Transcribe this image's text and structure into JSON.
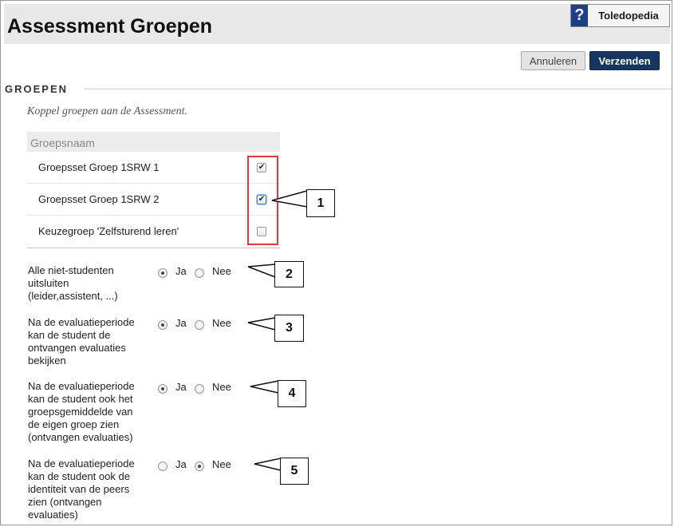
{
  "header": {
    "title": "Assessment Groepen",
    "help_icon": "question-mark",
    "help_label": "Toledopedia"
  },
  "actions": {
    "cancel_label": "Annuleren",
    "submit_label": "Verzenden"
  },
  "section": {
    "title": "GROEPEN",
    "description": "Koppel groepen aan de Assessment."
  },
  "groups": {
    "column_header": "Groepsnaam",
    "rows": [
      {
        "name": "Groepsset Groep 1SRW 1",
        "checked": true
      },
      {
        "name": "Groepsset Groep 1SRW 2",
        "checked": true
      },
      {
        "name": "Keuzegroep 'Zelfsturend leren'",
        "checked": false
      }
    ]
  },
  "options": [
    {
      "label_lines": [
        "Alle niet-studenten",
        "uitsluiten",
        "(leider,assistent, ...)"
      ],
      "yes": "Ja",
      "no": "Nee",
      "selected": "Ja"
    },
    {
      "label_lines": [
        "Na de evaluatieperiode",
        "kan de student de",
        "ontvangen evaluaties",
        "bekijken"
      ],
      "yes": "Ja",
      "no": "Nee",
      "selected": "Ja"
    },
    {
      "label_lines": [
        "Na de evaluatieperiode",
        "kan de student ook het",
        "groepsgemiddelde van",
        "de eigen groep zien",
        "(ontvangen evaluaties)"
      ],
      "yes": "Ja",
      "no": "Nee",
      "selected": "Ja"
    },
    {
      "label_lines": [
        "Na de evaluatieperiode",
        "kan de student ook de",
        "identiteit van de peers",
        "zien (ontvangen",
        "evaluaties)"
      ],
      "yes": "Ja",
      "no": "Nee",
      "selected": "Nee"
    }
  ],
  "callouts": [
    "1",
    "2",
    "3",
    "4",
    "5"
  ],
  "colors": {
    "submit_bg": "#15375f",
    "help_icon_bg": "#1b3f8b",
    "highlight_red": "#e0393e",
    "header_bg": "#e8e8e8"
  }
}
